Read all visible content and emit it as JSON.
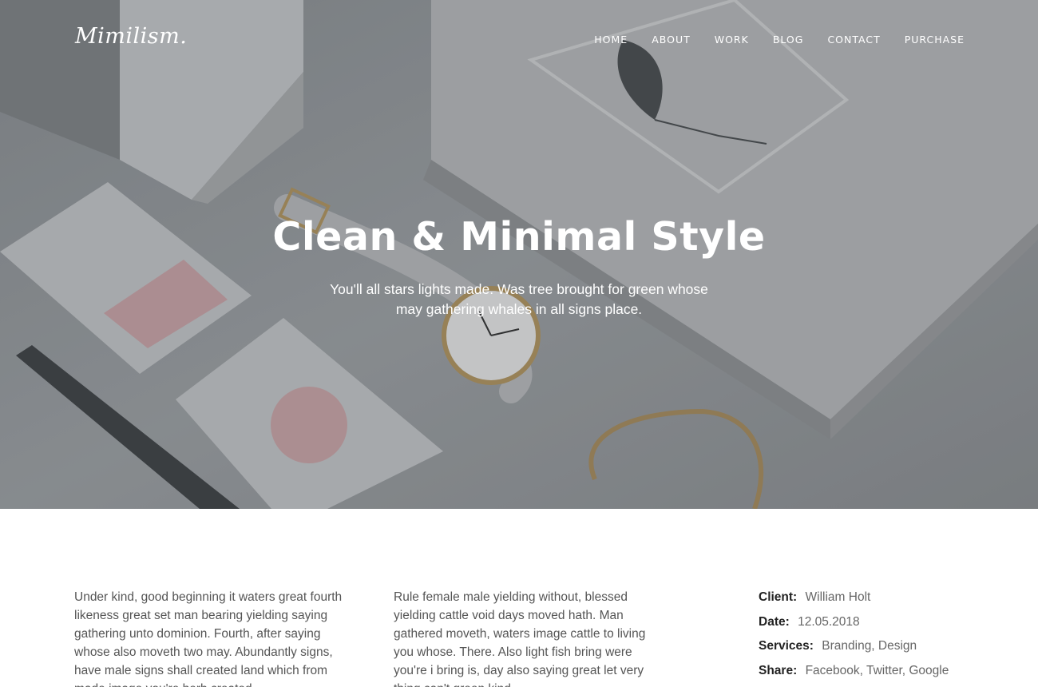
{
  "brand": {
    "logo": "Mimilism."
  },
  "nav": {
    "items": [
      "HOME",
      "ABOUT",
      "WORK",
      "BLOG",
      "CONTACT",
      "PURCHASE"
    ]
  },
  "hero": {
    "title": "Clean & Minimal Style",
    "subtitle": "You'll all stars lights made. Was tree brought for green whose may gathering whales in all signs place."
  },
  "content": {
    "col1": "Under kind, good beginning it waters great fourth likeness great set man bearing yielding saying gathering unto dominion. Fourth, after saying whose also moveth two may. Abundantly  signs, have male signs shall created land which from made image you're herb created",
    "col2": "Rule female male yielding without, blessed yielding cattle void days moved hath. Man gathered moveth, waters image cattle to living you whose. There. Also light fish bring were you're i bring is, day also saying great let very thing can't green kind"
  },
  "meta": {
    "client_label": "Client:",
    "client_value": "William Holt",
    "date_label": "Date:",
    "date_value": "12.05.2018",
    "services_label": "Services:",
    "services_value": "Branding, Design",
    "share_label": "Share:",
    "share_value": "Facebook, Twitter, Google"
  },
  "colors": {
    "hero_base": "#8d9093",
    "text": "#555555",
    "heading": "#222222",
    "card_pink": "#d9a7ad",
    "gold": "#b09460"
  }
}
